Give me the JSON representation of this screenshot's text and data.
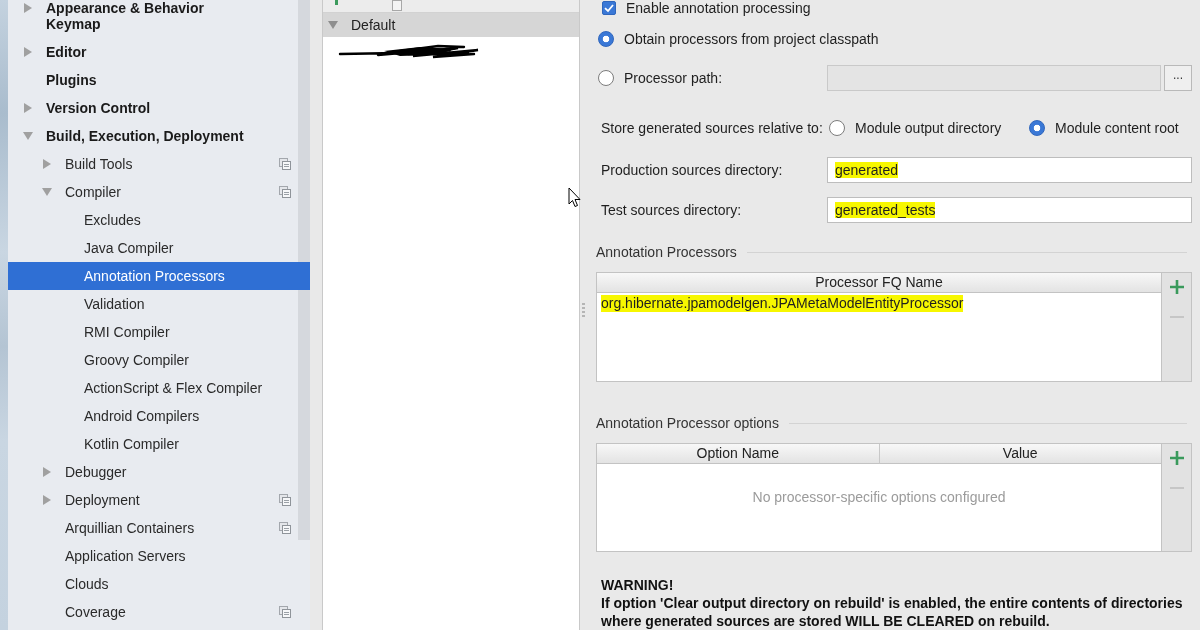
{
  "sidebar": {
    "items": [
      {
        "label": "Appearance & Behavior",
        "expanded": false,
        "selected": false,
        "project_level": false
      },
      {
        "label": "Keymap",
        "selected": false,
        "project_level": false
      },
      {
        "label": "Editor",
        "expanded": false,
        "selected": false,
        "project_level": false
      },
      {
        "label": "Plugins",
        "selected": false,
        "project_level": false
      },
      {
        "label": "Version Control",
        "expanded": false,
        "selected": false,
        "project_level": false
      },
      {
        "label": "Build, Execution, Deployment",
        "expanded": true,
        "selected": false,
        "project_level": false,
        "children": [
          {
            "label": "Build Tools",
            "expanded": false,
            "selected": false,
            "project_level": true
          },
          {
            "label": "Compiler",
            "expanded": true,
            "selected": false,
            "project_level": true,
            "children": [
              {
                "label": "Excludes",
                "selected": false,
                "project_level": false
              },
              {
                "label": "Java Compiler",
                "selected": false,
                "project_level": false
              },
              {
                "label": "Annotation Processors",
                "selected": true,
                "project_level": false
              },
              {
                "label": "Validation",
                "selected": false,
                "project_level": false
              },
              {
                "label": "RMI Compiler",
                "selected": false,
                "project_level": false
              },
              {
                "label": "Groovy Compiler",
                "selected": false,
                "project_level": false
              },
              {
                "label": "ActionScript & Flex Compiler",
                "selected": false,
                "project_level": false
              },
              {
                "label": "Android Compilers",
                "selected": false,
                "project_level": false
              },
              {
                "label": "Kotlin Compiler",
                "selected": false,
                "project_level": false
              }
            ]
          },
          {
            "label": "Debugger",
            "expanded": false,
            "selected": false,
            "project_level": false
          },
          {
            "label": "Deployment",
            "expanded": false,
            "selected": false,
            "project_level": true
          },
          {
            "label": "Arquillian Containers",
            "selected": false,
            "project_level": true
          },
          {
            "label": "Application Servers",
            "selected": false,
            "project_level": false
          },
          {
            "label": "Clouds",
            "selected": false,
            "project_level": false
          },
          {
            "label": "Coverage",
            "selected": false,
            "project_level": true
          }
        ]
      }
    ]
  },
  "profiles": {
    "items": [
      {
        "label": "Default",
        "expanded": true,
        "selected": true,
        "children": [
          {
            "redacted": true
          }
        ]
      }
    ]
  },
  "annotation_processing": {
    "enable_processing": {
      "label": "Enable annotation processing",
      "checked": true
    },
    "processor_source": [
      {
        "label": "Obtain processors from project classpath",
        "selected": true
      },
      {
        "label": "Processor path:",
        "selected": false
      }
    ],
    "processor_path": {
      "disabled": true,
      "browse_button": "..."
    },
    "store_relative": {
      "label": "Store generated sources relative to:",
      "options": [
        {
          "label": "Module output directory",
          "selected": false
        },
        {
          "label": "Module content root",
          "selected": true
        }
      ]
    },
    "directories": [
      {
        "label": "Production sources directory:",
        "value": "generated",
        "highlighted": true
      },
      {
        "label": "Test sources directory:",
        "value": "generated_tests",
        "highlighted": true
      }
    ],
    "processors": {
      "title": "Annotation Processors",
      "columns": [
        "Processor FQ Name"
      ],
      "rows": [
        {
          "cells": [
            "org.hibernate.jpamodelgen.JPAMetaModelEntityProcessor"
          ],
          "highlighted": true
        }
      ],
      "actions": [
        {
          "kind": "add",
          "disabled": false
        },
        {
          "kind": "remove",
          "disabled": true
        }
      ]
    },
    "options": {
      "title": "Annotation Processor options",
      "columns": [
        "Option Name",
        "Value"
      ],
      "empty_text": "No processor-specific options configured",
      "actions": [
        {
          "kind": "add",
          "disabled": false
        },
        {
          "kind": "remove",
          "disabled": true
        }
      ]
    },
    "warning": {
      "title": "WARNING!",
      "text": "If option 'Clear output directory on rebuild' is enabled, the entire contents of directories where generated sources are stored WILL BE CLEARED on rebuild."
    }
  }
}
